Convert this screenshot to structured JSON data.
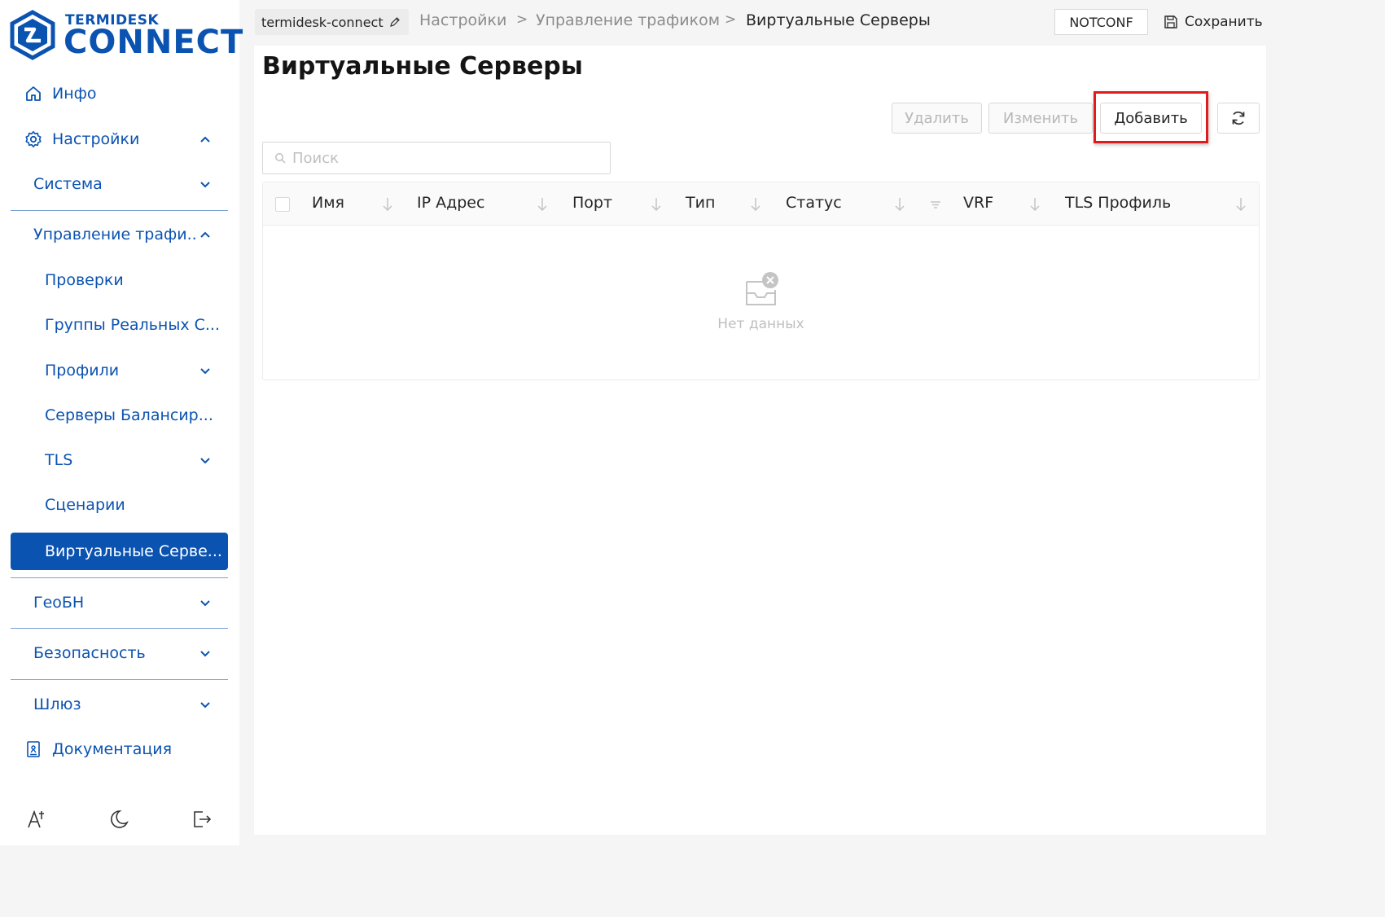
{
  "brand": {
    "top": "TERMIDESK",
    "main": "CONNECT"
  },
  "sidebar": {
    "items": [
      {
        "label": "Инфо",
        "icon": "home-icon"
      },
      {
        "label": "Настройки",
        "icon": "gear-icon"
      },
      {
        "label": "Система"
      },
      {
        "label": "Управление трафи..."
      },
      {
        "label": "Проверки"
      },
      {
        "label": "Группы Реальных С..."
      },
      {
        "label": "Профили"
      },
      {
        "label": "Серверы Балансир..."
      },
      {
        "label": "TLS"
      },
      {
        "label": "Сценарии"
      },
      {
        "label": "Виртуальные Серве..."
      },
      {
        "label": "ГеоБН"
      },
      {
        "label": "Безопасность"
      },
      {
        "label": "Шлюз"
      },
      {
        "label": "Документация",
        "icon": "documentation-icon"
      }
    ],
    "bottom_tools": [
      "font-size-icon",
      "dark-mode-icon",
      "logout-icon"
    ]
  },
  "header": {
    "project": "termidesk-connect",
    "breadcrumbs": [
      "Настройки",
      "Управление трафиком",
      "Виртуальные Серверы"
    ],
    "separator": ">",
    "status": "NOTCONF",
    "save_label": "Сохранить"
  },
  "page": {
    "title": "Виртуальные Серверы",
    "actions": {
      "delete": "Удалить",
      "edit": "Изменить",
      "add": "Добавить"
    },
    "search_placeholder": "Поиск",
    "table": {
      "columns": [
        "Имя",
        "IP Адрес",
        "Порт",
        "Тип",
        "Статус",
        "VRF",
        "TLS Профиль"
      ],
      "rows": [],
      "empty_text": "Нет данных"
    }
  },
  "colors": {
    "accent": "#0b53b1",
    "highlight": "#e01b1b"
  }
}
